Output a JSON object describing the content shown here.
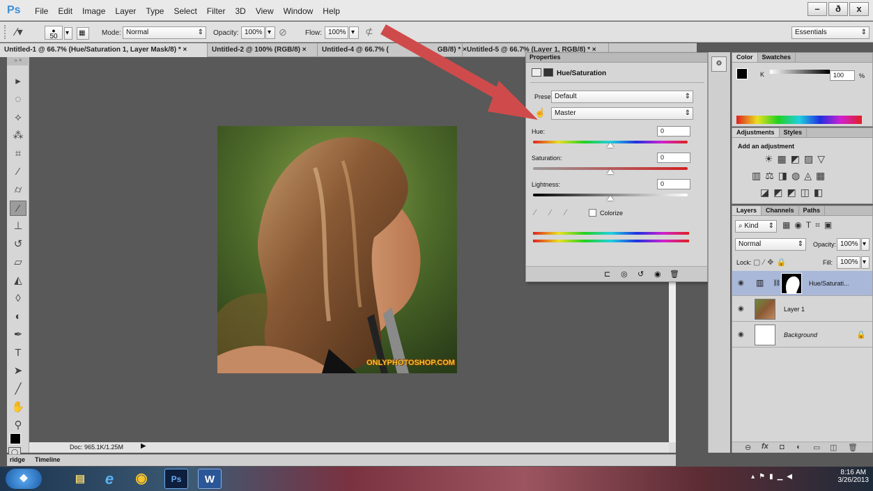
{
  "app": {
    "logo": "Ps"
  },
  "menu": [
    "File",
    "Edit",
    "Image",
    "Layer",
    "Type",
    "Select",
    "Filter",
    "3D",
    "View",
    "Window",
    "Help"
  ],
  "window_buttons": {
    "minimize": "–",
    "maximize": "ð",
    "close": "x"
  },
  "options": {
    "brush_size": "50",
    "mode_label": "Mode:",
    "mode_value": "Normal",
    "opacity_label": "Opacity:",
    "opacity_value": "100%",
    "flow_label": "Flow:",
    "flow_value": "100%",
    "workspace": "Essentials"
  },
  "doc_tabs": [
    {
      "label": "Untitled-1 @ 66.7% (Hue/Saturation 1, Layer Mask/8) * ×"
    },
    {
      "label": "Untitled-2 @ 100% (RGB/8) ×"
    },
    {
      "label": "Untitled-4 @ 66.7% (",
      "label_tail": "GB/8) * ×"
    },
    {
      "label": "Untitled-5 @ 66.7% (Layer 1, RGB/8) * ×"
    }
  ],
  "canvas": {
    "watermark": "ONLYPHOTOSHOP.COM"
  },
  "status": {
    "doc": "Doc: 965.1K/1.25M"
  },
  "bottom_tabs": {
    "bridge": "ridge",
    "timeline": "Timeline"
  },
  "properties": {
    "title": "Properties",
    "adjustment": "Hue/Saturation",
    "preset_label": "Preset:",
    "preset_value": "Default",
    "channel_value": "Master",
    "hue_label": "Hue:",
    "hue_value": "0",
    "saturation_label": "Saturation:",
    "saturation_value": "0",
    "lightness_label": "Lightness:",
    "lightness_value": "0",
    "colorize_label": "Colorize"
  },
  "color_panel": {
    "tabs": [
      "Color",
      "Swatches"
    ],
    "channel": "K",
    "value": "100",
    "unit": "%"
  },
  "adjustments_panel": {
    "tabs": [
      "Adjustments",
      "Styles"
    ],
    "heading": "Add an adjustment"
  },
  "layers_panel": {
    "tabs": [
      "Layers",
      "Channels",
      "Paths"
    ],
    "kind": "Kind",
    "blend_mode": "Normal",
    "opacity_label": "Opacity:",
    "opacity_value": "100%",
    "lock_label": "Lock:",
    "fill_label": "Fill:",
    "fill_value": "100%",
    "layers": [
      {
        "name": "Hue/Saturati..."
      },
      {
        "name": "Layer 1"
      },
      {
        "name": "Background"
      }
    ]
  },
  "taskbar": {
    "time": "8:16 AM",
    "date": "3/26/2013",
    "ps_icon": "Ps",
    "word_icon": "W"
  },
  "accent": {
    "arrow": "#cf4b4b",
    "selection": "#a9b8d9"
  }
}
